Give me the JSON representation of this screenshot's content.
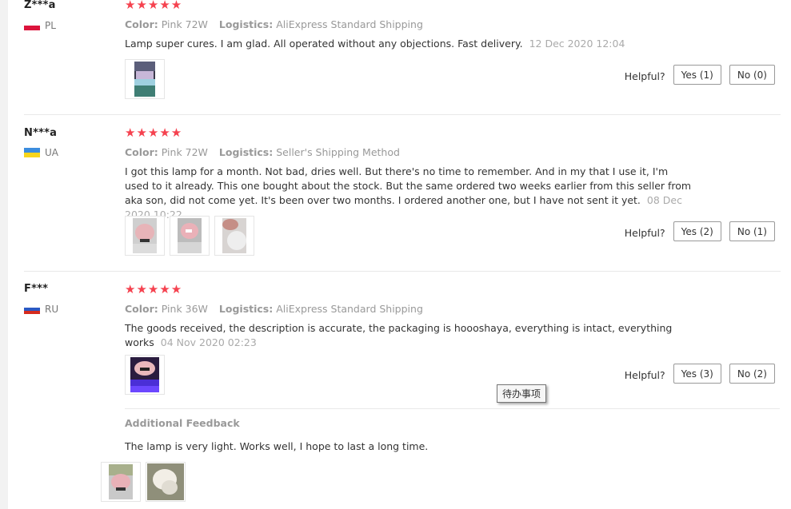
{
  "reviews": [
    {
      "name": "Z***a",
      "country": "PL",
      "flag_colors": [
        "#ffffff",
        "#dc143c"
      ],
      "stars": "★★★★★",
      "rating": 5,
      "color_label": "Color:",
      "color_value": "Pink 72W",
      "logistics_label": "Logistics:",
      "logistics_value": "AliExpress Standard Shipping",
      "text": "Lamp super cures. I am glad. All operated without any objections. Fast delivery.",
      "date": "12 Dec 2020 12:04",
      "helpful_label": "Helpful?",
      "yes_label": "Yes (1)",
      "no_label": "No (0)"
    },
    {
      "name": "N***a",
      "country": "UA",
      "flag_colors": [
        "#3c8dde",
        "#f7d51d"
      ],
      "stars": "★★★★★",
      "rating": 5,
      "color_label": "Color:",
      "color_value": "Pink 72W",
      "logistics_label": "Logistics:",
      "logistics_value": "Seller's Shipping Method",
      "text": "I got this lamp for a month. Not bad, dries well. But there's no time to remember. And in my that I use it, I'm used to it already. This one bought about the stock. But the same ordered two weeks earlier from this seller from aka son, did not come yet. It's been over two months. I ordered another one, but I have not sent it yet.",
      "date": "08 Dec 2020 10:22",
      "helpful_label": "Helpful?",
      "yes_label": "Yes (2)",
      "no_label": "No (1)"
    },
    {
      "name": "F***",
      "country": "RU",
      "flag_colors": [
        "#ffffff",
        "#2b59c3",
        "#d52b1e"
      ],
      "stars": "★★★★★",
      "rating": 5,
      "color_label": "Color:",
      "color_value": "Pink 36W",
      "logistics_label": "Logistics:",
      "logistics_value": "AliExpress Standard Shipping",
      "text": "The goods received, the description is accurate, the packaging is hoooshaya, everything is intact, everything works",
      "date": "04 Nov 2020 02:23",
      "helpful_label": "Helpful?",
      "yes_label": "Yes (3)",
      "no_label": "No (2)",
      "additional_title": "Additional Feedback",
      "additional_text": "The lamp is very light. Works well, I hope to last a long time."
    }
  ],
  "tooltip": "待办事项",
  "colors": {
    "star": "#f5424f",
    "meta_gray": "#999999",
    "text": "#333333",
    "divider": "#e8e8e8"
  }
}
